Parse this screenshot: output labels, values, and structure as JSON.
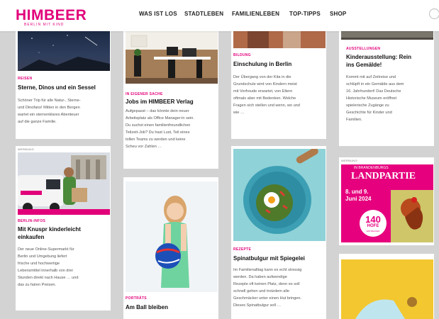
{
  "logo": {
    "name": "HIMBEER",
    "tagline": "BERLIN MIT KIND"
  },
  "nav": {
    "items": [
      "WAS IST LOS",
      "STADTLEBEN",
      "FAMILIENLEBEN",
      "TOP-TIPPS",
      "SHOP"
    ]
  },
  "colors": {
    "brand": "#e2007a"
  },
  "cards": {
    "c1": {
      "category": "REISEN",
      "title": "Sterne, Dinos und ein Sessel",
      "desc": [
        "Schöner Trip für alle Natur-, Sterne-",
        "und Dinofans! Mitten in den Bergen",
        "wartet ein sternenklares Abenteuer",
        "auf die ganze Familie."
      ]
    },
    "c2": {
      "tag": "WERBUNG",
      "category": "BERLIN-INFOS",
      "title": [
        "Mit Knuspr kinderleicht",
        "einkaufen"
      ],
      "desc": [
        "Der neue Online-Supermarkt für",
        "Berlin und Umgebung liefert",
        "frische und hochwertige",
        "Lebensmittel innerhalb von drei",
        "Stunden direkt nach Hause … und",
        "das zu fairen Preisen."
      ]
    },
    "c3": {
      "category": "IN EIGENER SACHE",
      "title": "Jobs im HIMBEER Verlag",
      "desc": [
        "Aufgepasst – das könnte dein neuer",
        "Arbeitsplatz als Office Manager:in sein.",
        "Du suchst einen familienfreundlichen",
        "Teilzeit-Job? Du hast Lust, Teil eines",
        "tollen Teams zu werden und keine",
        "Scheu vor Zahlen …"
      ]
    },
    "c4": {
      "category": "PORTRÄTS",
      "title": "Am Ball bleiben"
    },
    "c5": {
      "category": "BILDUNG",
      "title": "Einschulung in Berlin",
      "desc": [
        "Der Übergang von der Kita in die",
        "Grundschule wird von Kindern meist",
        "mit Vorfreude erwartet, von Eltern",
        "oftmals aber mit Bedenken. Welche",
        "Fragen sich stellen und wenn, wo und",
        "wie …"
      ]
    },
    "c6": {
      "category": "REZEPTE",
      "title": "Spinatbulgur mit Spiegelei",
      "desc": [
        "Im Familienalltag kann es echt stressig",
        "werden. Da haben aufwendige",
        "Rezepte oft keinen Platz, denn es soll",
        "schnell gehen und trotzdem alle",
        "Geschmäcker unter einen Hut bringen.",
        "Dieses Spinatbulgur soll …"
      ]
    },
    "c7": {
      "category": "AUSSTELLUNGEN",
      "title": [
        "Kinderausstellung: Rein",
        "ins Gemälde!"
      ],
      "desc": [
        "Kommt mit auf Zeitreise und",
        "schlüpft in ein Gemälde aus dem",
        "16. Jahrhundert! Das Deutsche",
        "Historische Museum eröffnet",
        "spielerische Zugänge zu",
        "Geschichte für Kinder und",
        "Familien."
      ]
    },
    "c8": {
      "tag": "WERBUNG",
      "ad_line1": "IN BRANDENBURGS",
      "ad_line2": "LANDPARTIE",
      "ad_dates": [
        "8. und 9.",
        "Juni 2024"
      ],
      "ad_badge_num": "140",
      "ad_badge_word": "HÖFE",
      "ad_badge_small": "ENTDECKEN"
    }
  }
}
